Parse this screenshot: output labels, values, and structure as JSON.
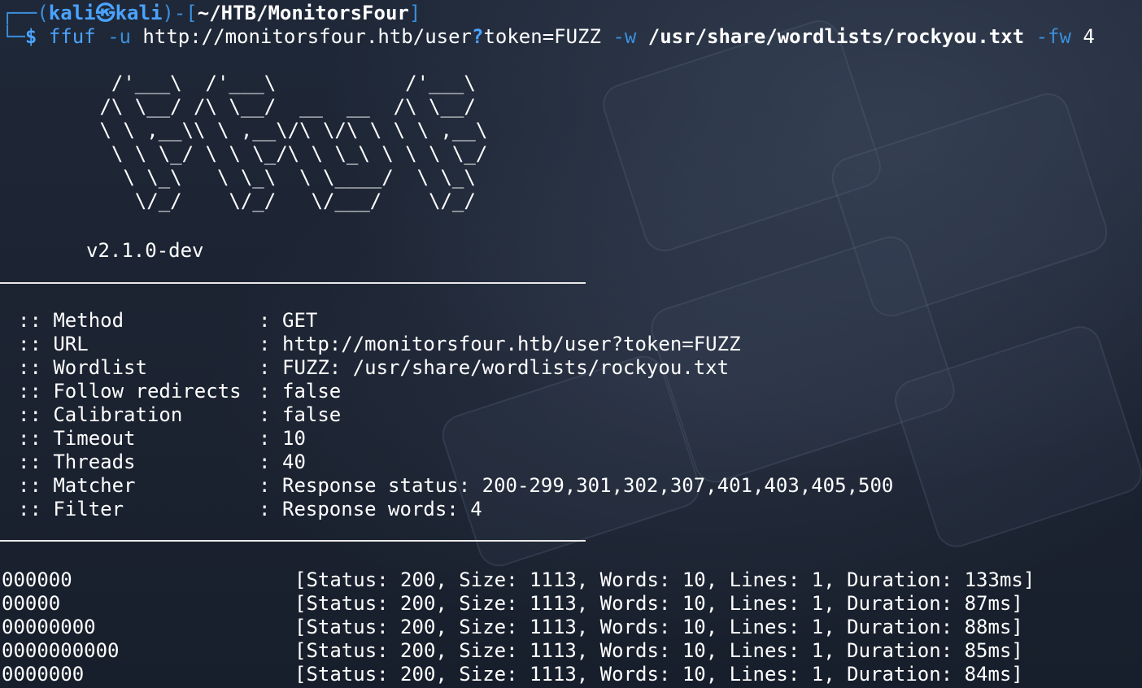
{
  "prompt": {
    "corner_top": "┌──(",
    "user": "kali",
    "at_icon": "㉿",
    "host": "kali",
    "mid": ")-[",
    "path": "~/HTB/MonitorsFour",
    "close": "]",
    "corner_bottom": "└─",
    "dollar": "$"
  },
  "command": {
    "program": "ffuf",
    "flag_u": "-u",
    "url_part1": "http://monitorsfour.htb/user",
    "url_q": "?",
    "url_part2": "token=FUZZ",
    "flag_w": "-w",
    "wordlist": "/usr/share/wordlists/rockyou.txt",
    "flag_fw": "-fw",
    "fw_value": "4"
  },
  "banner": {
    "ascii_lines": [
      "  /'___\\  /'___\\           /'___\\",
      " /\\ \\__/ /\\ \\__/  __  __  /\\ \\__/",
      " \\ \\ ,__\\\\ \\ ,__\\/\\ \\/\\ \\ \\ \\ ,__\\",
      "  \\ \\ \\_/ \\ \\ \\_/\\ \\ \\_\\ \\ \\ \\ \\_/",
      "   \\ \\_\\   \\ \\_\\  \\ \\____/  \\ \\_\\",
      "    \\/_/    \\/_/   \\/___/    \\/_/"
    ],
    "version": "v2.1.0-dev",
    "separator": "________________________________________________"
  },
  "config": [
    {
      "label": ":: Method",
      "value": "GET"
    },
    {
      "label": ":: URL",
      "value": "http://monitorsfour.htb/user?token=FUZZ"
    },
    {
      "label": ":: Wordlist",
      "value": "FUZZ: /usr/share/wordlists/rockyou.txt"
    },
    {
      "label": ":: Follow redirects",
      "value": "false"
    },
    {
      "label": ":: Calibration",
      "value": "false"
    },
    {
      "label": ":: Timeout",
      "value": "10"
    },
    {
      "label": ":: Threads",
      "value": "40"
    },
    {
      "label": ":: Matcher",
      "value": "Response status: 200-299,301,302,307,401,403,405,500"
    },
    {
      "label": ":: Filter",
      "value": "Response words: 4"
    }
  ],
  "config_colon": ":",
  "results": [
    {
      "word": "000000",
      "info": "[Status: 200, Size: 1113, Words: 10, Lines: 1, Duration: 133ms]"
    },
    {
      "word": "00000",
      "info": "[Status: 200, Size: 1113, Words: 10, Lines: 1, Duration: 87ms]"
    },
    {
      "word": "00000000",
      "info": "[Status: 200, Size: 1113, Words: 10, Lines: 1, Duration: 88ms]"
    },
    {
      "word": "0000000000",
      "info": "[Status: 200, Size: 1113, Words: 10, Lines: 1, Duration: 85ms]"
    },
    {
      "word": "0000000",
      "info": "[Status: 200, Size: 1113, Words: 10, Lines: 1, Duration: 84ms]"
    }
  ],
  "colors": {
    "prompt_blue": "#4aa3ff",
    "frame_blue": "#3b8edb",
    "text": "#ffffff",
    "background": "#1b2333"
  }
}
